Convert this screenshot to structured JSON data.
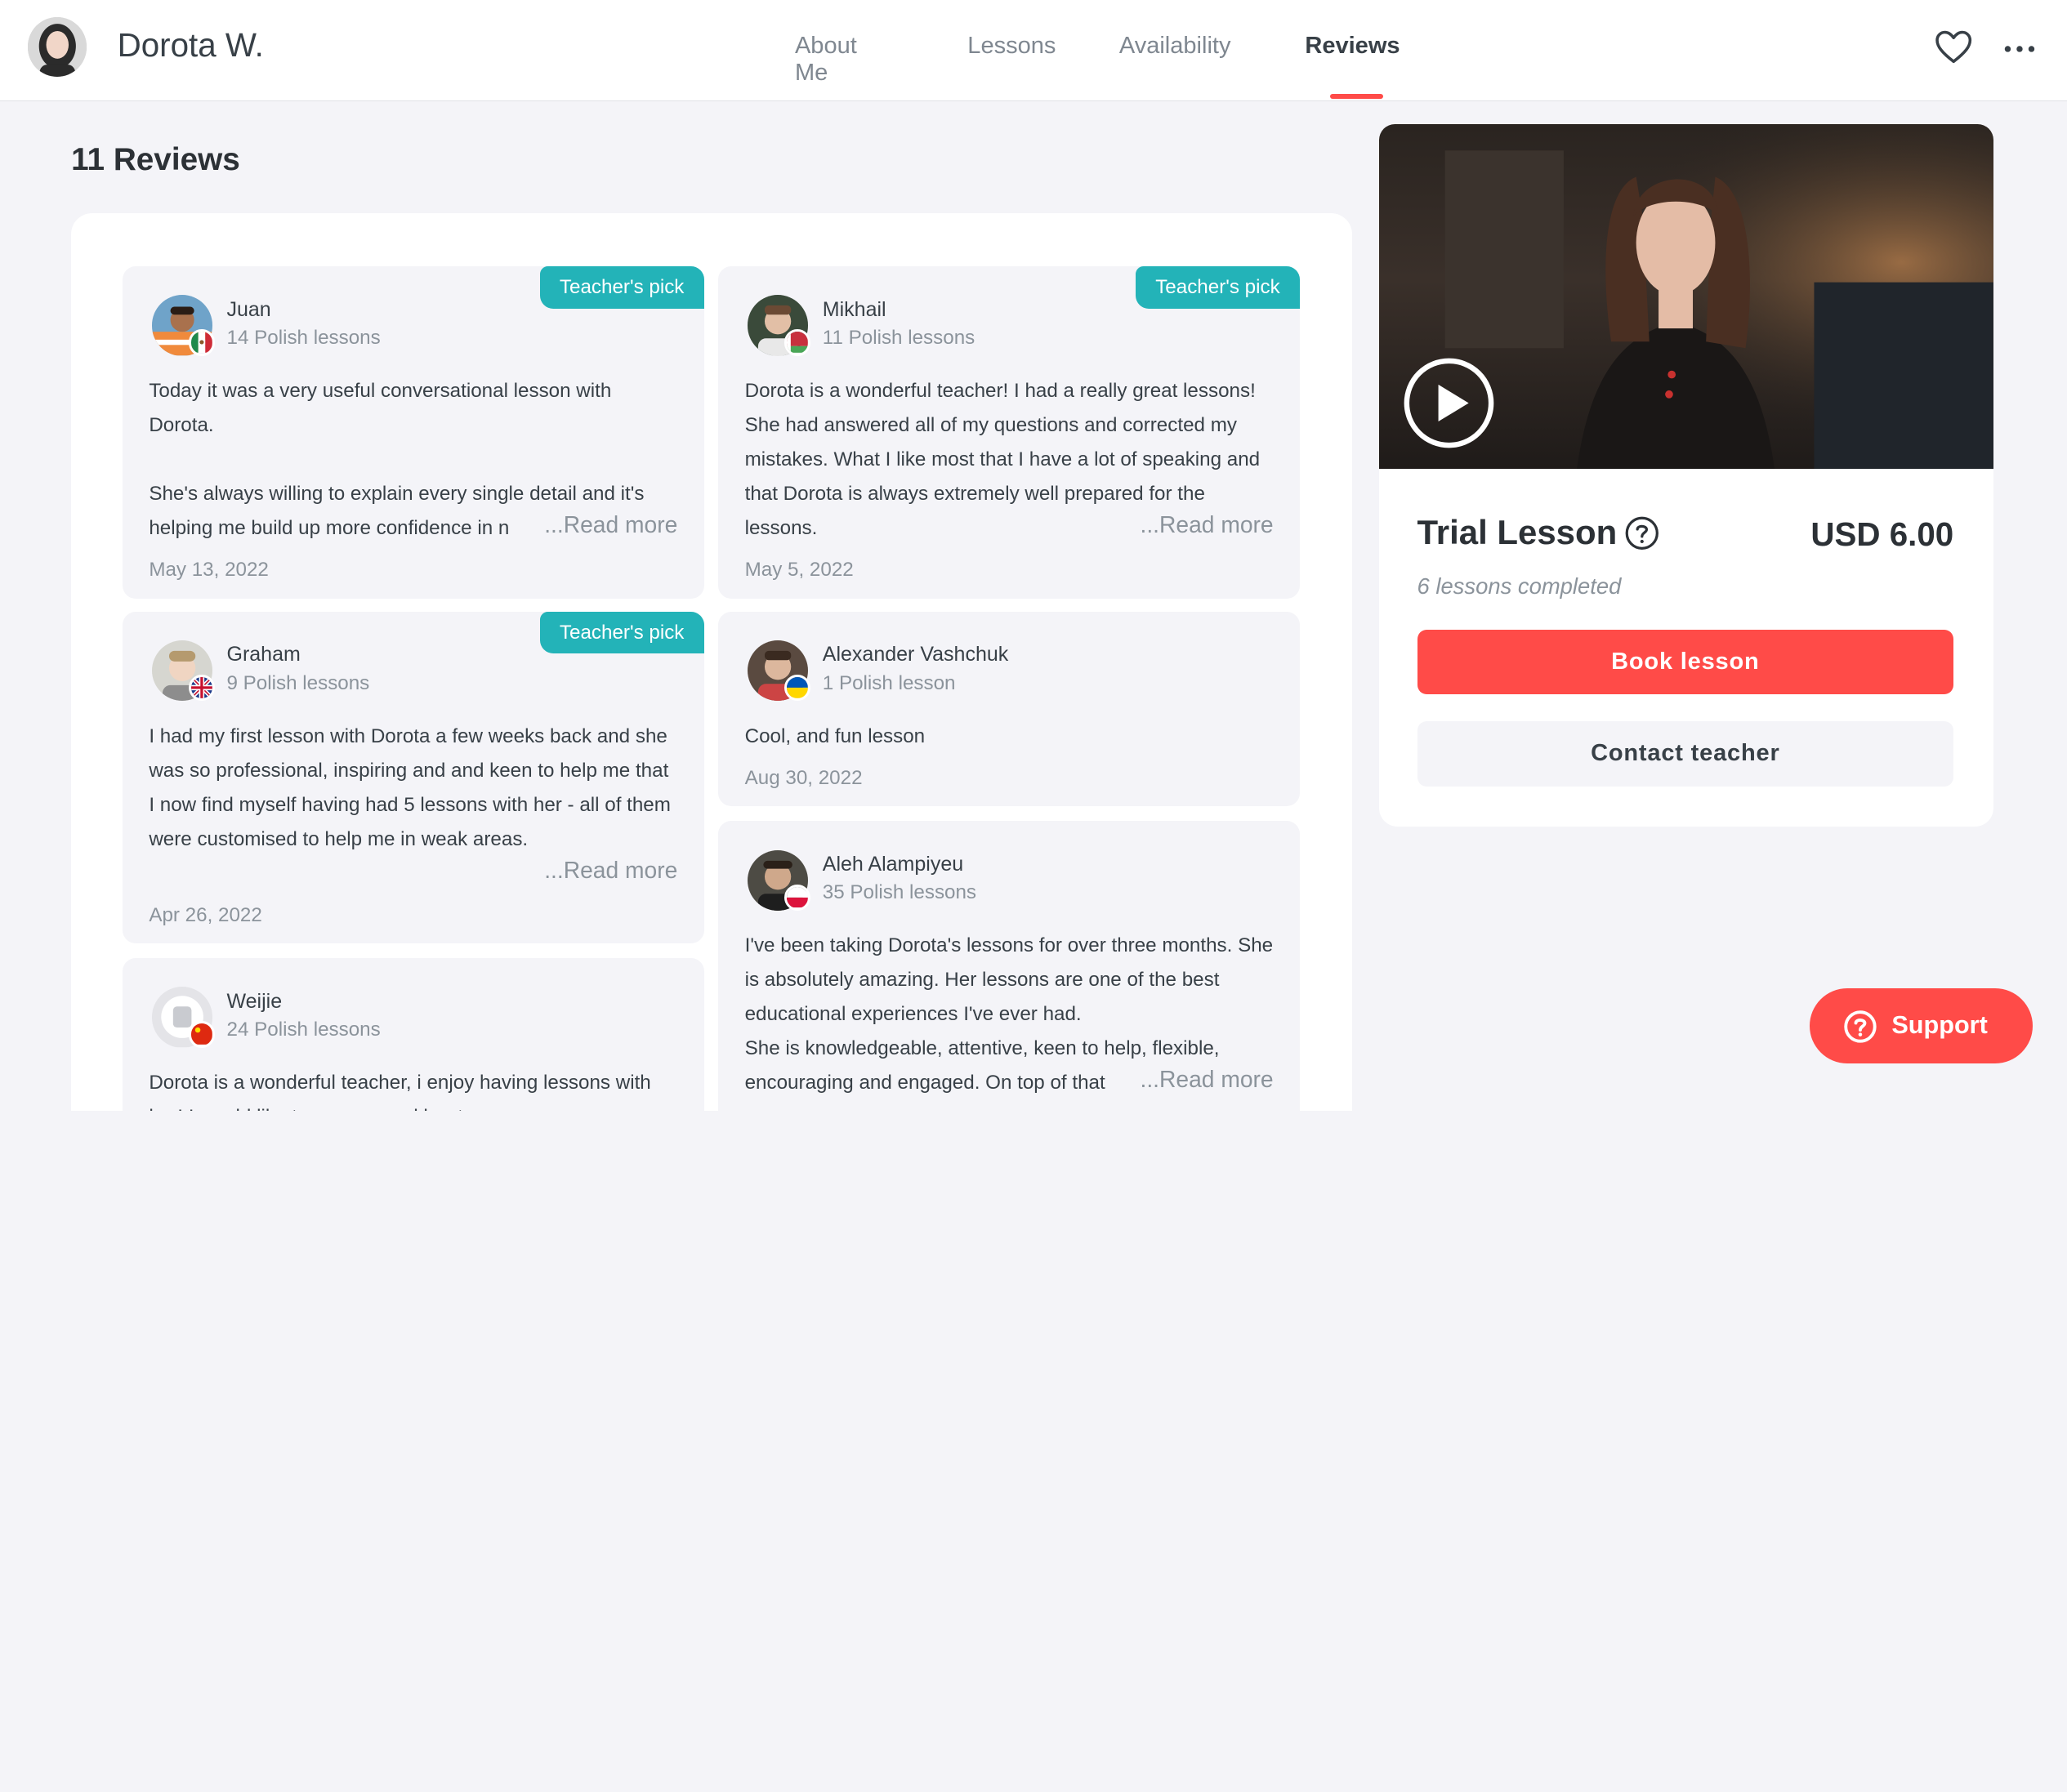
{
  "header": {
    "teacher_name": "Dorota W.",
    "nav": [
      "About Me",
      "Lessons",
      "Availability",
      "Reviews"
    ],
    "active_tab": "Reviews",
    "icons": [
      "heart-icon",
      "more-icon"
    ]
  },
  "reviews": {
    "title": "11 Reviews",
    "items": [
      {
        "name": "Juan",
        "count": "14 Polish lessons",
        "pick": "Teacher's pick",
        "text": "Today it was a very useful conversational lesson with Dorota.\n\nShe's always willing to explain every single detail and it's helping me build up more confidence in n",
        "read_more": "...Read more",
        "date": "May 13, 2022",
        "flag": "mexico"
      },
      {
        "name": "Mikhail",
        "count": "11 Polish lessons",
        "pick": "Teacher's pick",
        "text": "Dorota is a wonderful teacher! I had a really great lessons! She had answered all of my questions and corrected my mistakes. What I like most that I have a lot of speaking and that Dorota is always extremely well prepared for the lessons.",
        "read_more": "...Read more",
        "date": "May 5, 2022",
        "flag": "belarus"
      },
      {
        "name": "Graham",
        "count": "9 Polish lessons",
        "pick": "Teacher's pick",
        "text": "I had my first lesson with Dorota a few weeks back and she was so professional, inspiring and and keen to help me that I now find myself having had 5 lessons with her - all of them were customised to help me in weak areas.",
        "read_more": "...Read more",
        "date": "Apr 26, 2022",
        "flag": "uk"
      },
      {
        "name": "Alexander Vashchuk",
        "count": "1 Polish lesson",
        "text": "Cool, and fun lesson",
        "date": "Aug 30, 2022",
        "flag": "ukraine"
      },
      {
        "name": "Weijie",
        "count": "24 Polish lessons",
        "text": "Dorota is a wonderful teacher, i enjoy having lessons with her! I would like to recommend her to everyone",
        "flag": "china"
      },
      {
        "name": "Aleh Alampiyeu",
        "count": "35 Polish lessons",
        "text": "I've been taking Dorota's lessons for over three months. She is absolutely amazing. Her lessons are one of the best educational experiences I've ever had.\nShe is knowledgeable, attentive, keen to help, flexible, encouraging and engaged. On top of that",
        "read_more": "...Read more",
        "flag": "poland"
      }
    ]
  },
  "booking": {
    "trial_title": "Trial Lesson",
    "price": "USD 6.00",
    "completed": "6 lessons completed",
    "book_label": "Book lesson",
    "contact_label": "Contact teacher",
    "icons": [
      "play-icon",
      "help-icon"
    ]
  },
  "support": {
    "label": "Support",
    "icon": "question-icon"
  },
  "colors": {
    "accent": "#ff4b48",
    "teal": "#23b3b8",
    "text": "#384047",
    "muted": "#8b939b",
    "bg": "#f4f4f8"
  }
}
